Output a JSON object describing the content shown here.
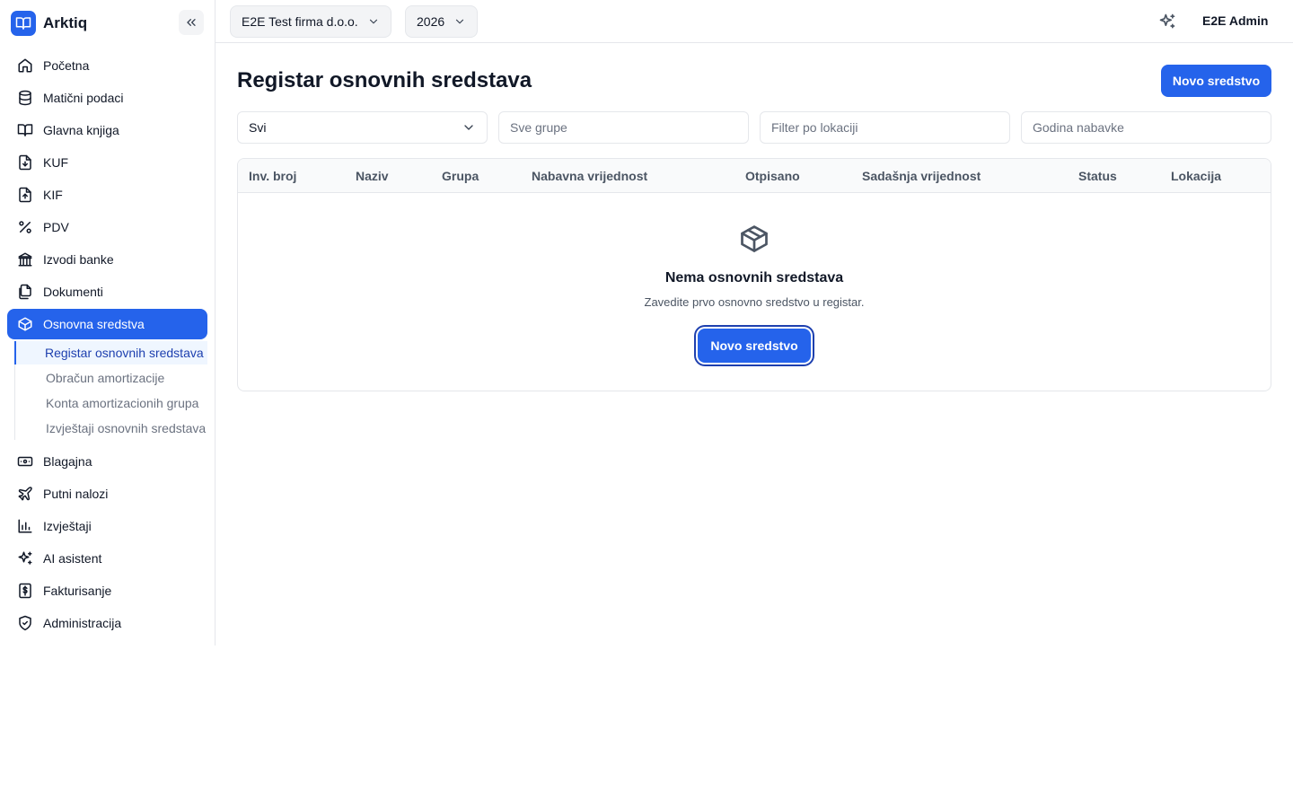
{
  "app": {
    "name": "Arktiq"
  },
  "sidebar": {
    "items": [
      {
        "label": "Početna",
        "icon": "home-icon"
      },
      {
        "label": "Matični podaci",
        "icon": "database-icon"
      },
      {
        "label": "Glavna knjiga",
        "icon": "book-open-icon"
      },
      {
        "label": "KUF",
        "icon": "file-download-icon"
      },
      {
        "label": "KIF",
        "icon": "file-upload-icon"
      },
      {
        "label": "PDV",
        "icon": "percent-icon"
      },
      {
        "label": "Izvodi banke",
        "icon": "bank-icon"
      },
      {
        "label": "Dokumenti",
        "icon": "files-icon"
      },
      {
        "label": "Osnovna sredstva",
        "icon": "package-icon"
      },
      {
        "label": "Blagajna",
        "icon": "banknote-icon"
      },
      {
        "label": "Putni nalozi",
        "icon": "plane-icon"
      },
      {
        "label": "Izvještaji",
        "icon": "bar-chart-icon"
      },
      {
        "label": "AI asistent",
        "icon": "sparkles-icon"
      },
      {
        "label": "Fakturisanje",
        "icon": "invoice-dollar-icon"
      },
      {
        "label": "Administracija",
        "icon": "shield-check-icon"
      }
    ],
    "active_item": "Osnovna sredstva",
    "subitems": [
      {
        "label": "Registar osnovnih sredstava"
      },
      {
        "label": "Obračun amortizacije"
      },
      {
        "label": "Konta amortizacionih grupa"
      },
      {
        "label": "Izvještaji osnovnih sredstava"
      }
    ],
    "active_subitem": "Registar osnovnih sredstava"
  },
  "topbar": {
    "company": "E2E Test firma d.o.o.",
    "year": "2026",
    "user": "E2E Admin"
  },
  "main": {
    "title": "Registar osnovnih sredstava",
    "new_button": "Novo sredstvo",
    "filters": {
      "status_value": "Svi",
      "group_placeholder": "Sve grupe",
      "location_placeholder": "Filter po lokaciji",
      "year_placeholder": "Godina nabavke"
    },
    "table": {
      "columns": [
        "Inv. broj",
        "Naziv",
        "Grupa",
        "Nabavna vrijednost",
        "Otpisano",
        "Sadašnja vrijednost",
        "Status",
        "Lokacija"
      ]
    },
    "empty": {
      "title": "Nema osnovnih sredstava",
      "description": "Zavedite prvo osnovno sredstvo u registar.",
      "button": "Novo sredstvo"
    }
  },
  "colors": {
    "accent": "#2563eb",
    "active_sub_bg": "#eff6ff",
    "active_sub_text": "#1e40af"
  }
}
